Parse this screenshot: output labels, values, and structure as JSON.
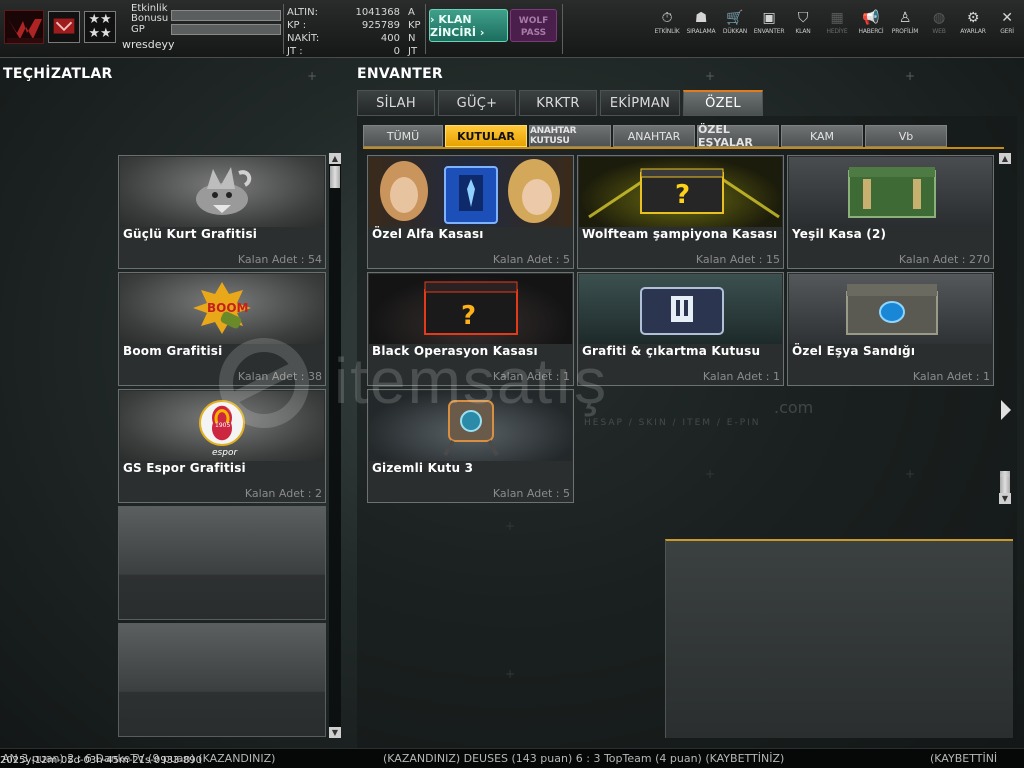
{
  "header": {
    "event_bonus_label_line1": "Etkinlik",
    "event_bonus_label_line2": "Bonusu",
    "gp_label": "GP",
    "username": "wresdeyy",
    "currency": [
      {
        "label": "ALTIN:",
        "value": "1041368",
        "unit": "A"
      },
      {
        "label": "KP :",
        "value": "925789",
        "unit": "KP"
      },
      {
        "label": "NAKİT:",
        "value": "400",
        "unit": "N"
      },
      {
        "label": "JT :",
        "value": "0",
        "unit": "JT"
      }
    ],
    "klan_button": "› KLAN ZİNCİRİ ›",
    "wolf_pass_line1": "WOLF",
    "wolf_pass_line2": "PASS",
    "nav": [
      {
        "label": "ETKİNLİK",
        "icon": "stopwatch-icon",
        "glyph": "⏱",
        "enabled": true
      },
      {
        "label": "SIRALAMA",
        "icon": "medal-icon",
        "glyph": "☗",
        "enabled": true
      },
      {
        "label": "DÜKKAN",
        "icon": "cart-icon",
        "glyph": "🛒",
        "enabled": true
      },
      {
        "label": "ENVANTER",
        "icon": "inventory-icon",
        "glyph": "▣",
        "enabled": true
      },
      {
        "label": "KLAN",
        "icon": "shield-icon",
        "glyph": "⛉",
        "enabled": true
      },
      {
        "label": "HEDİYE",
        "icon": "gift-icon",
        "glyph": "▦",
        "enabled": false
      },
      {
        "label": "HABERCİ",
        "icon": "megaphone-icon",
        "glyph": "📢",
        "enabled": true
      },
      {
        "label": "PROFİLİM",
        "icon": "profile-icon",
        "glyph": "♙",
        "enabled": true
      },
      {
        "label": "WEB",
        "icon": "globe-icon",
        "glyph": "◍",
        "enabled": false
      },
      {
        "label": "AYARLAR",
        "icon": "gear-icon",
        "glyph": "⚙",
        "enabled": true
      },
      {
        "label": "GERİ",
        "icon": "close-icon",
        "glyph": "✕",
        "enabled": true
      }
    ]
  },
  "left": {
    "title": "TEÇHİZATLAR",
    "items": [
      {
        "name": "Güçlü Kurt Grafitisi",
        "qty": "Kalan Adet : 54"
      },
      {
        "name": "Boom Grafitisi",
        "qty": "Kalan Adet : 38"
      },
      {
        "name": "GS Espor Grafitisi",
        "qty": "Kalan Adet : 2"
      }
    ],
    "gs_badge_text": "1905",
    "gs_espor_text": "espor"
  },
  "inventory": {
    "title": "ENVANTER",
    "tabs": [
      "SİLAH",
      "GÜÇ+",
      "KRKTR",
      "EKİPMAN",
      "ÖZEL"
    ],
    "active_tab": "ÖZEL",
    "subtabs": [
      "TÜMÜ",
      "KUTULAR",
      "ANAHTAR KUTUSU",
      "ANAHTAR",
      "ÖZEL EŞYALAR",
      "KAM",
      "Vb"
    ],
    "active_subtab": "KUTULAR",
    "items": [
      {
        "name": "Özel Alfa Kasası",
        "qty": "Kalan Adet : 5"
      },
      {
        "name": "Wolfteam şampiyona Kasası",
        "qty": "Kalan Adet : 15"
      },
      {
        "name": "Yeşil Kasa (2)",
        "qty": "Kalan Adet : 270"
      },
      {
        "name": "Black Operasyon Kasası",
        "qty": "Kalan Adet : 1"
      },
      {
        "name": "Grafiti & çıkartma Kutusu",
        "qty": "Kalan Adet : 1"
      },
      {
        "name": "Özel Eşya Sandığı",
        "qty": "Kalan Adet : 1"
      },
      {
        "name": "Gizemli Kutu 3",
        "qty": "Kalan Adet : 5"
      }
    ]
  },
  "watermark": {
    "text": "itemsatış",
    "dotcom": ".com",
    "sub": "HESAP / SKIN / ITEM / E-PIN"
  },
  "ticker": {
    "timestamp": "2025y-12m-05d-03h-45m-21s-0933-890",
    "segments": [
      "AN 3 puan) 2 : 6 DankeTV (9 puan) (KAZANDINIZ)",
      "(KAZANDINIZ) DEUSES (143 puan) 6 : 3 TopTeam (4 puan) (KAYBETTİNİZ)",
      "(KAYBETTİNİ"
    ]
  }
}
